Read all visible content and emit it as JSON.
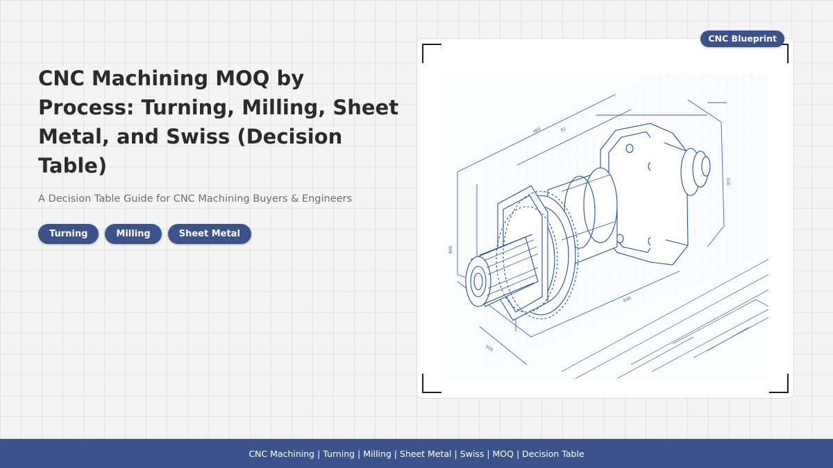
{
  "hero": {
    "title": "CNC Machining MOQ by Process: Turning, Milling, Sheet Metal, and Swiss (Decision Table)",
    "subtitle": "A Decision Table Guide for CNC Machining Buyers & Engineers",
    "tags": [
      {
        "label": "Turning"
      },
      {
        "label": "Milling"
      },
      {
        "label": "Sheet Metal"
      }
    ]
  },
  "image_card": {
    "badge": "CNC Blueprint",
    "illustration": "cnc-part-blueprint",
    "line_color": "#1f4fa8"
  },
  "footer": {
    "text": "CNC Machining | Turning | Milling | Sheet Metal | Swiss | MOQ | Decision Table"
  },
  "colors": {
    "accent": "#3b528b",
    "title": "#2b2b2b",
    "subtitle": "#6d6d6d",
    "background": "#f4f4f4",
    "grid": "#e3e3e3"
  }
}
